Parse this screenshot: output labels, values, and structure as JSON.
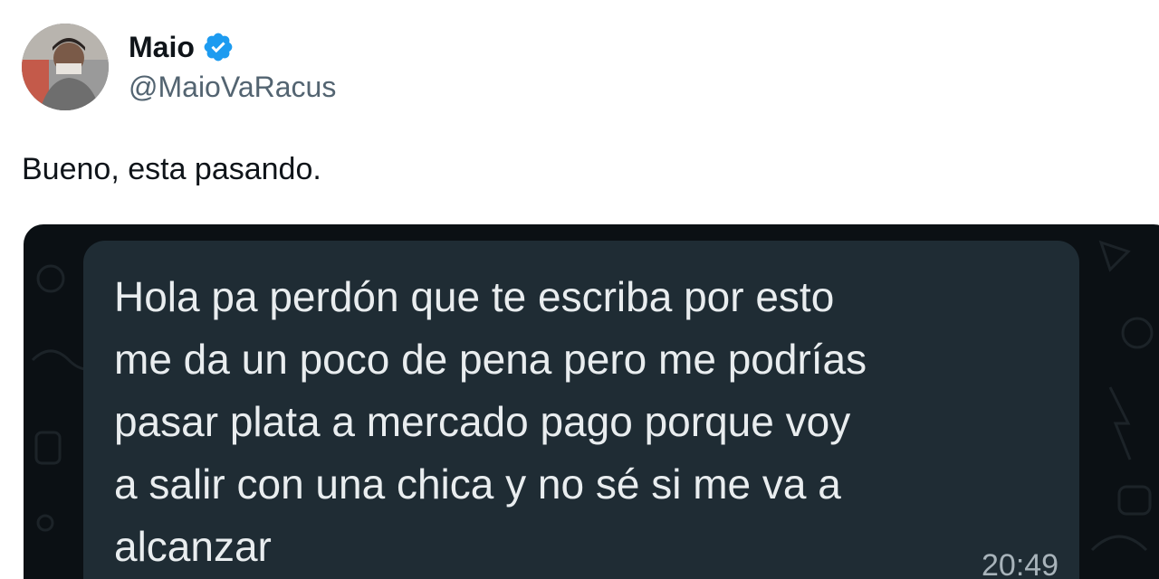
{
  "author": {
    "display_name": "Maio",
    "handle": "@MaioVaRacus",
    "verified": true
  },
  "tweet": {
    "text": "Bueno, esta pasando."
  },
  "media": {
    "message_text": "Hola pa perdón que te escriba por esto\nme da un poco de pena pero me podrías\npasar plata a mercado pago porque voy\na salir con una chica y no sé si me va a\nalcanzar",
    "time": "20:49"
  },
  "icons": {
    "verified": "verified-badge-icon",
    "avatar": "profile-photo"
  },
  "colors": {
    "verified_blue": "#1d9bf0",
    "bubble": "#1f2c34",
    "chat_background": "#0b1014"
  }
}
